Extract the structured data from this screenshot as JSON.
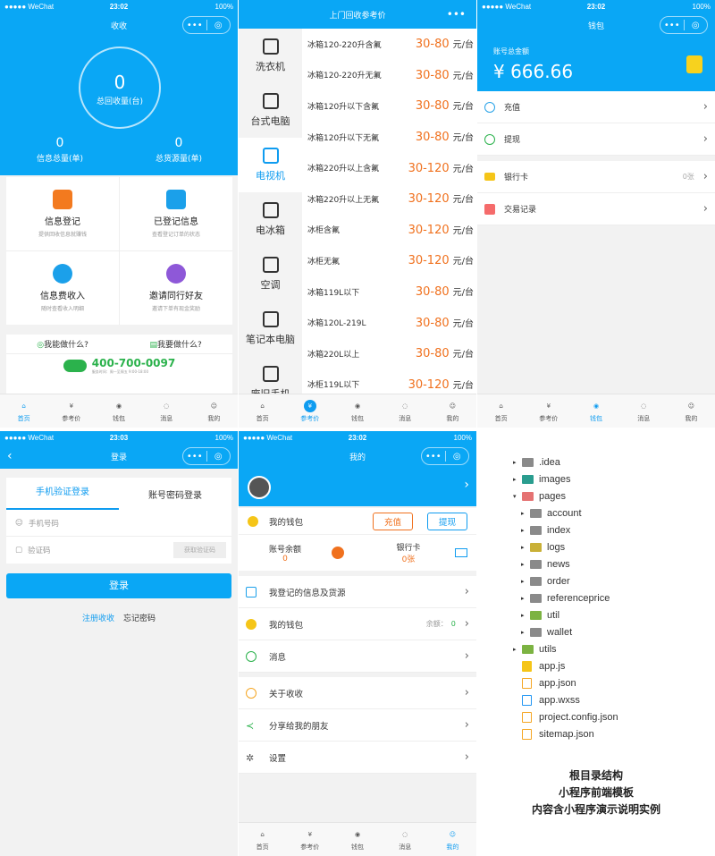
{
  "status": {
    "carrier": "●●●●● WeChat",
    "p1_time": "23:02",
    "p2_time": "23:02",
    "p3_time": "23:02",
    "p4_time": "23:03",
    "p5_time": "23:02",
    "battery": "100%"
  },
  "capsule": {
    "dots": "•••",
    "target": "◎"
  },
  "tabs": [
    "首页",
    "参考价",
    "钱包",
    "消息",
    "我的"
  ],
  "p1": {
    "title": "收收",
    "total_value": "0",
    "total_label": "总回收量(台)",
    "info_value": "0",
    "info_label": "信息总量(单)",
    "goods_value": "0",
    "goods_label": "总货源量(单)",
    "cards": [
      {
        "t": "信息登记",
        "s": "提供回收信息就赚钱"
      },
      {
        "t": "已登记信息",
        "s": "查看登记订单的状态"
      },
      {
        "t": "信息费收入",
        "s": "随时查看收入明细"
      },
      {
        "t": "邀请同行好友",
        "s": "邀请下单有现金奖励"
      }
    ],
    "can_do": "我能做什么?",
    "want_do": "我要做什么?",
    "phone": "400-700-0097",
    "phone_sub": "服务时间：周一至周五 9:00-18:00"
  },
  "p2": {
    "title": "上门回收参考价",
    "cats": [
      "洗衣机",
      "台式电脑",
      "电视机",
      "电冰箱",
      "空调",
      "笔记本电脑",
      "废旧手机"
    ],
    "items": [
      {
        "n": "冰箱120-220升含氟",
        "p": "30-80",
        "u": "元/台"
      },
      {
        "n": "冰箱120-220升无氟",
        "p": "30-80",
        "u": "元/台"
      },
      {
        "n": "冰箱120升以下含氟",
        "p": "30-80",
        "u": "元/台"
      },
      {
        "n": "冰箱120升以下无氟",
        "p": "30-80",
        "u": "元/台"
      },
      {
        "n": "冰箱220升以上含氟",
        "p": "30-120",
        "u": "元/台"
      },
      {
        "n": "冰箱220升以上无氟",
        "p": "30-120",
        "u": "元/台"
      },
      {
        "n": "冰柜含氟",
        "p": "30-120",
        "u": "元/台"
      },
      {
        "n": "冰柜无氟",
        "p": "30-120",
        "u": "元/台"
      },
      {
        "n": "冰箱119L以下",
        "p": "30-80",
        "u": "元/台"
      },
      {
        "n": "冰箱120L-219L",
        "p": "30-80",
        "u": "元/台"
      },
      {
        "n": "冰箱220L以上",
        "p": "30-80",
        "u": "元/台"
      },
      {
        "n": "冰柜119L以下",
        "p": "30-120",
        "u": "元/台"
      }
    ]
  },
  "p3": {
    "title": "钱包",
    "label": "账号总金额",
    "amount": "¥ 666.66",
    "rows": [
      "充值",
      "提现"
    ],
    "rows2": [
      "银行卡",
      "交易记录"
    ],
    "bank_count": "0张"
  },
  "p4": {
    "title": "登录",
    "tab_sms": "手机验证登录",
    "tab_pwd": "账号密码登录",
    "phone_ph": "手机号码",
    "code_ph": "验证码",
    "get_code": "获取验证码",
    "login": "登录",
    "register": "注册收收",
    "forgot": "忘记密码"
  },
  "p5": {
    "title": "我的",
    "wallet": "我的钱包",
    "recharge": "充值",
    "withdraw": "提现",
    "balance_label": "账号余额",
    "balance": "0",
    "card_label": "银行卡",
    "card": "0张",
    "rows": [
      "我登记的信息及货源",
      "我的钱包",
      "消息"
    ],
    "wallet_hint": "余额：",
    "wallet_val": "0",
    "rows2": [
      "关于收收",
      "分享给我的朋友",
      "设置"
    ]
  },
  "p6": {
    "tree": [
      {
        "n": ".idea",
        "t": "folder",
        "d": 0,
        "a": "▸"
      },
      {
        "n": "images",
        "t": "folder-teal",
        "d": 0,
        "a": "▸"
      },
      {
        "n": "pages",
        "t": "folder-red",
        "d": 0,
        "a": "▾"
      },
      {
        "n": "account",
        "t": "folder",
        "d": 1,
        "a": "▸"
      },
      {
        "n": "index",
        "t": "folder",
        "d": 1,
        "a": "▸"
      },
      {
        "n": "logs",
        "t": "folder-yellow",
        "d": 1,
        "a": "▸"
      },
      {
        "n": "news",
        "t": "folder",
        "d": 1,
        "a": "▸"
      },
      {
        "n": "order",
        "t": "folder",
        "d": 1,
        "a": "▸"
      },
      {
        "n": "referenceprice",
        "t": "folder",
        "d": 1,
        "a": "▸"
      },
      {
        "n": "util",
        "t": "folder-green",
        "d": 1,
        "a": "▸"
      },
      {
        "n": "wallet",
        "t": "folder",
        "d": 1,
        "a": "▸"
      },
      {
        "n": "utils",
        "t": "folder-green",
        "d": 0,
        "a": "▸"
      },
      {
        "n": "app.js",
        "t": "js",
        "d": 0,
        "a": ""
      },
      {
        "n": "app.json",
        "t": "json",
        "d": 0,
        "a": ""
      },
      {
        "n": "app.wxss",
        "t": "wxss",
        "d": 0,
        "a": ""
      },
      {
        "n": "project.config.json",
        "t": "json",
        "d": 0,
        "a": ""
      },
      {
        "n": "sitemap.json",
        "t": "json",
        "d": 0,
        "a": ""
      }
    ],
    "caption": [
      "根目录结构",
      "小程序前端模板",
      "内容含小程序演示说明实例"
    ]
  },
  "colors": {
    "primary": "#0aa7f5",
    "price": "#f0711e"
  }
}
